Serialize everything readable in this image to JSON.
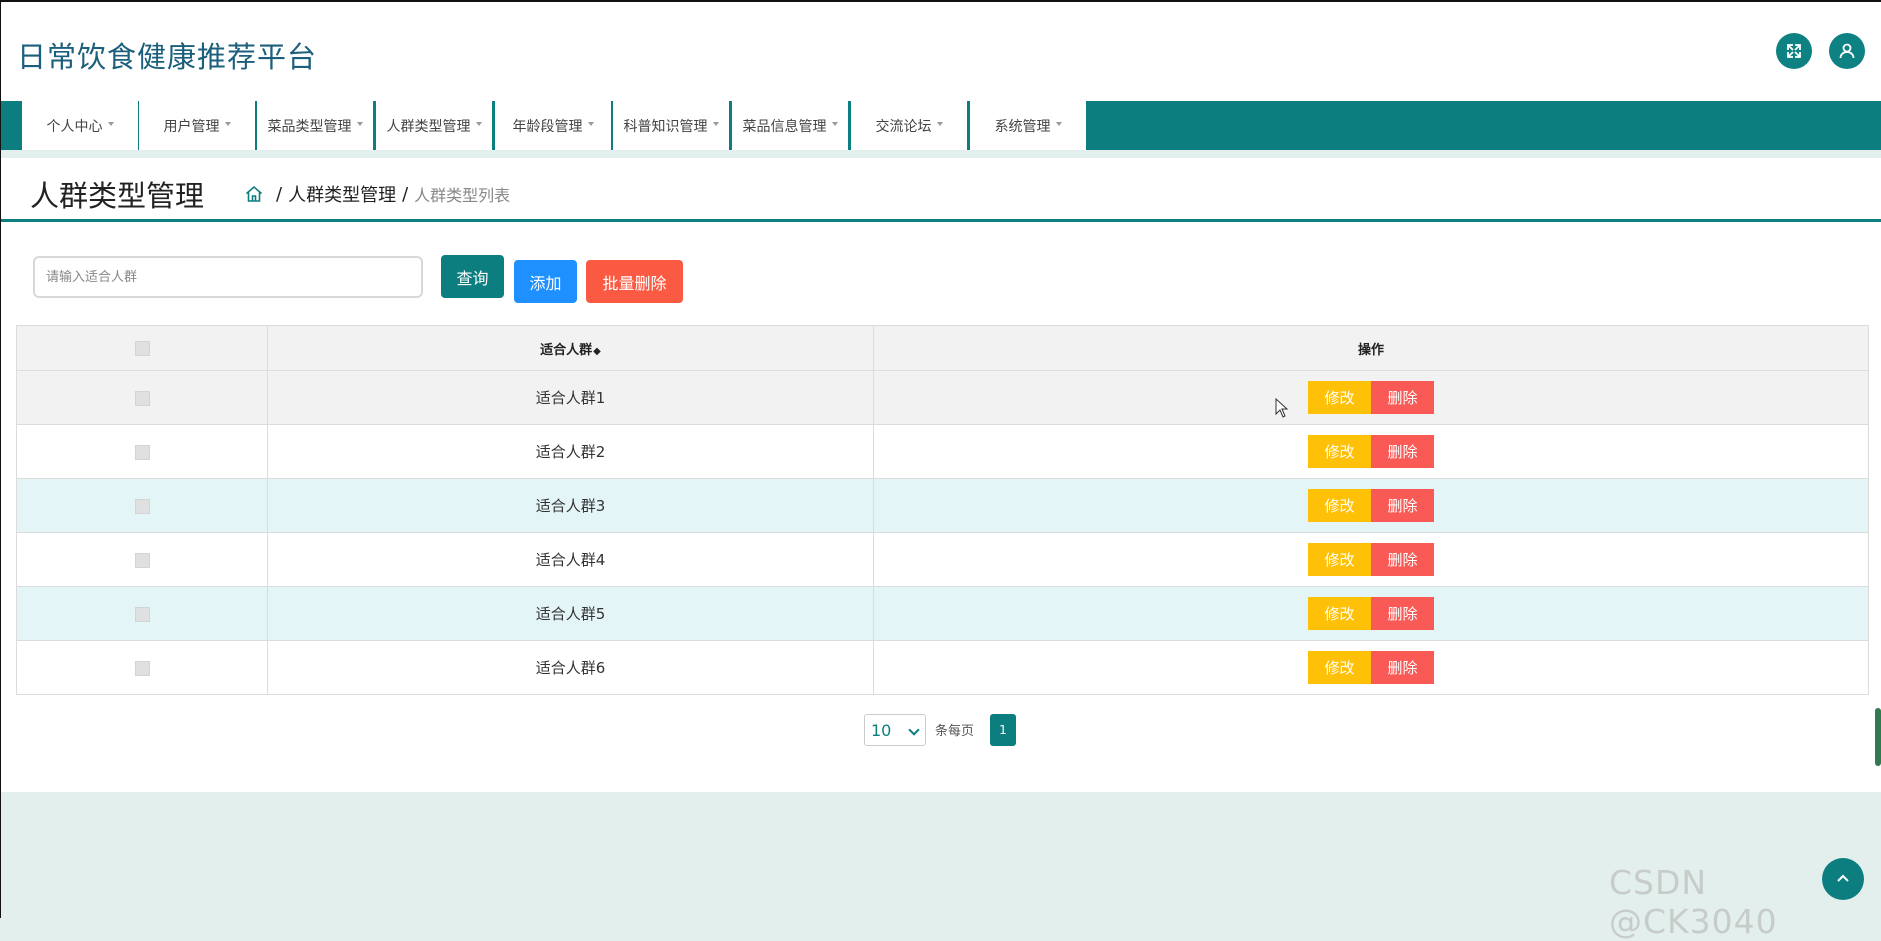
{
  "header": {
    "app_title": "日常饮食健康推荐平台",
    "icons": [
      "fullscreen-icon",
      "user-icon"
    ]
  },
  "nav": {
    "items": [
      {
        "label": "个人中心"
      },
      {
        "label": "用户管理"
      },
      {
        "label": "菜品类型管理"
      },
      {
        "label": "人群类型管理"
      },
      {
        "label": "年龄段管理"
      },
      {
        "label": "科普知识管理"
      },
      {
        "label": "菜品信息管理"
      },
      {
        "label": "交流论坛"
      },
      {
        "label": "系统管理"
      }
    ]
  },
  "page": {
    "title": "人群类型管理",
    "breadcrumb": {
      "home_icon": "home-icon",
      "separator": "/",
      "section": "人群类型管理",
      "current": "人群类型列表"
    }
  },
  "search": {
    "placeholder": "请输入适合人群",
    "value": "",
    "query_label": "查询",
    "add_label": "添加",
    "batch_delete_label": "批量删除"
  },
  "table": {
    "headers": {
      "name": "适合人群",
      "sort_icon": "◆",
      "actions": "操作"
    },
    "rows": [
      {
        "name": "适合人群1",
        "edit": "修改",
        "delete": "删除"
      },
      {
        "name": "适合人群2",
        "edit": "修改",
        "delete": "删除"
      },
      {
        "name": "适合人群3",
        "edit": "修改",
        "delete": "删除"
      },
      {
        "name": "适合人群4",
        "edit": "修改",
        "delete": "删除"
      },
      {
        "name": "适合人群5",
        "edit": "修改",
        "delete": "删除"
      },
      {
        "name": "适合人群6",
        "edit": "修改",
        "delete": "删除"
      }
    ]
  },
  "pagination": {
    "page_size": "10",
    "per_page_label": "条每页",
    "current_page": "1"
  },
  "watermark": "CSDN @CK3040",
  "colors": {
    "primary": "#0c7e80",
    "add": "#1e90ff",
    "danger": "#fa5a42",
    "edit": "#ffc107",
    "delete": "#fa5a55",
    "title_blue": "#1c5f7c",
    "background": "#e3efec"
  }
}
